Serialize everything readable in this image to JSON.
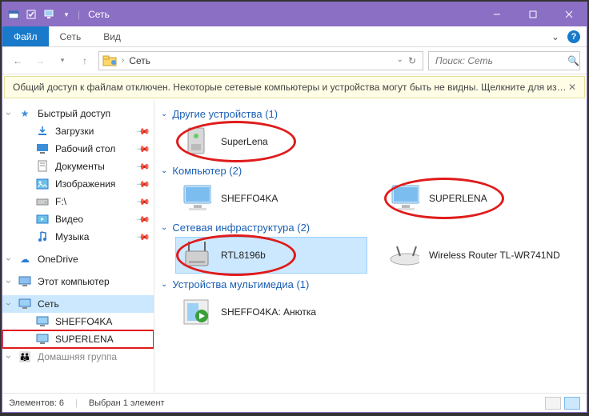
{
  "window": {
    "title": "Сеть"
  },
  "ribbon": {
    "file": "Файл",
    "tabs": [
      "Сеть",
      "Вид"
    ],
    "expand_hint": "⌄"
  },
  "address": {
    "crumb": "Сеть",
    "search_placeholder": "Поиск: Сеть"
  },
  "infobar": {
    "text": "Общий доступ к файлам отключен. Некоторые сетевые компьютеры и устройства могут быть не видны. Щелкните для из…"
  },
  "sidebar": {
    "quick_access": "Быстрый доступ",
    "quick_items": [
      {
        "label": "Загрузки",
        "icon": "download"
      },
      {
        "label": "Рабочий стол",
        "icon": "desktop"
      },
      {
        "label": "Документы",
        "icon": "documents"
      },
      {
        "label": "Изображения",
        "icon": "pictures"
      },
      {
        "label": "F:\\",
        "icon": "drive"
      },
      {
        "label": "Видео",
        "icon": "video"
      },
      {
        "label": "Музыка",
        "icon": "music"
      }
    ],
    "onedrive": "OneDrive",
    "this_pc": "Этот компьютер",
    "network": "Сеть",
    "network_items": [
      "SHEFFO4KA",
      "SUPERLENA"
    ],
    "homegroup": "Домашняя группа"
  },
  "content": {
    "groups": [
      {
        "title": "Другие устройства",
        "count": 1,
        "items": [
          {
            "label": "SuperLena",
            "icon": "device",
            "marked": true
          }
        ]
      },
      {
        "title": "Компьютер",
        "count": 2,
        "items": [
          {
            "label": "SHEFFO4KA",
            "icon": "pc"
          },
          {
            "label": "SUPERLENA",
            "icon": "pc",
            "marked": true
          }
        ]
      },
      {
        "title": "Сетевая инфраструктура",
        "count": 2,
        "items": [
          {
            "label": "RTL8196b",
            "icon": "router",
            "selected": true,
            "marked": true
          },
          {
            "label": "Wireless Router TL-WR741ND",
            "icon": "router2"
          }
        ]
      },
      {
        "title": "Устройства мультимедиа",
        "count": 1,
        "items": [
          {
            "label": "SHEFFO4KA: Анютка",
            "icon": "media"
          }
        ]
      }
    ]
  },
  "status": {
    "count_label": "Элементов: 6",
    "selection_label": "Выбран 1 элемент"
  },
  "annotations": {
    "red_ellipses": [
      "SuperLena",
      "SUPERLENA",
      "RTL8196b"
    ],
    "red_box": "SUPERLENA"
  }
}
